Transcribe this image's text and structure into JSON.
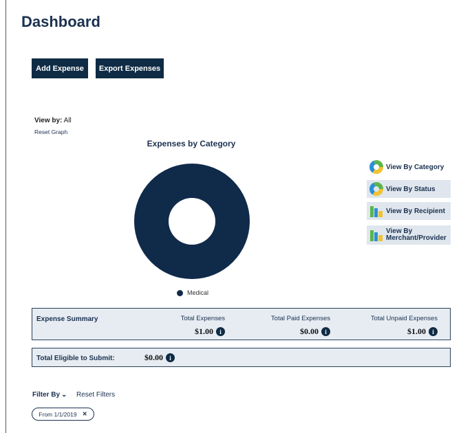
{
  "page": {
    "title": "Dashboard"
  },
  "actions": {
    "add_label": "Add Expense",
    "export_label": "Export Expenses"
  },
  "graph": {
    "view_by_label": "View by:",
    "view_by_value": "All",
    "reset_label": "Reset Graph"
  },
  "chart_data": {
    "type": "pie",
    "title": "Expenses by Category",
    "categories": [
      "Medical"
    ],
    "values": [
      1.0
    ],
    "colors": [
      "#102a4a"
    ],
    "donut": true
  },
  "view_options": [
    {
      "label": "View By Category",
      "icon": "donut-icon",
      "selected": false
    },
    {
      "label": "View By Status",
      "icon": "donut-icon",
      "selected": true
    },
    {
      "label": "View By Recipient",
      "icon": "bar-chart-icon",
      "selected": true
    },
    {
      "label": "View By Merchant/Provider",
      "icon": "bar-chart-icon",
      "selected": true
    }
  ],
  "summary": {
    "label": "Expense Summary",
    "total_label": "Total Expenses",
    "total_value": "$1.00",
    "paid_label": "Total Paid Expenses",
    "paid_value": "$0.00",
    "unpaid_label": "Total Unpaid Expenses",
    "unpaid_value": "$1.00"
  },
  "eligible": {
    "label": "Total Eligible to Submit:",
    "value": "$0.00"
  },
  "filters": {
    "filter_by_label": "Filter By",
    "reset_label": "Reset Filters",
    "chip_label": "From 1/1/2019",
    "chip_close": "✕"
  },
  "icons": {
    "info": "i",
    "chevron": "⌄"
  }
}
